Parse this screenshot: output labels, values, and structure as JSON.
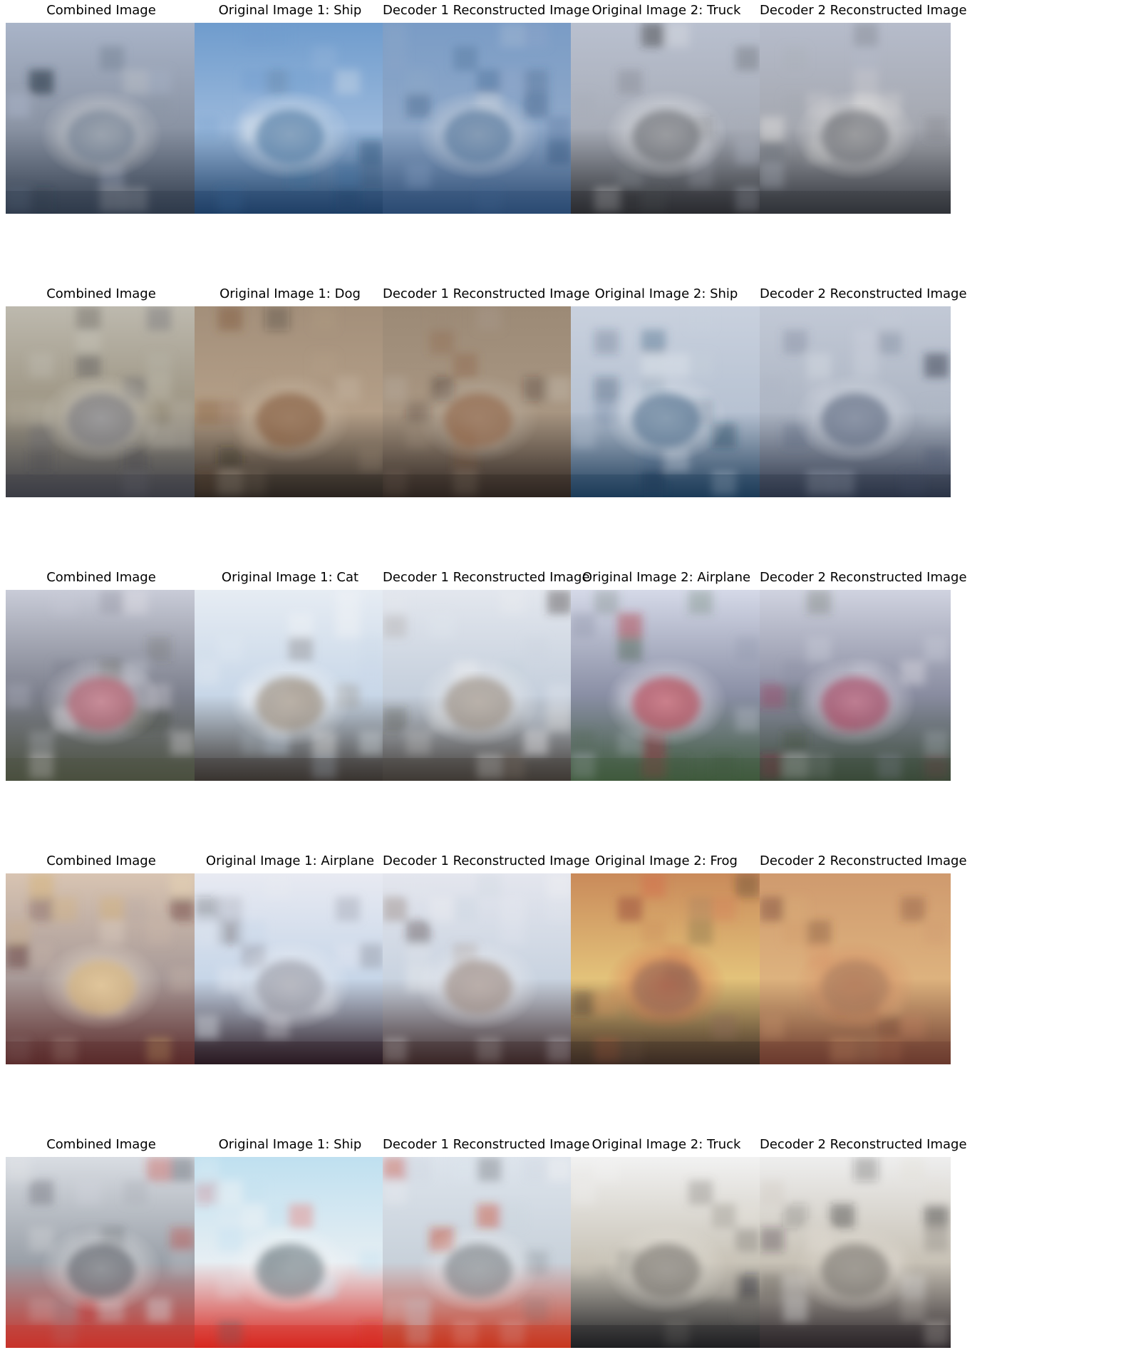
{
  "figure": {
    "rows": [
      {
        "cells": [
          {
            "title": "Combined Image",
            "image": "ship-and-truck-blend",
            "colors": [
              "#a9b4c8",
              "#8a93a3",
              "#e6e4e2",
              "#2f3a4a",
              "#5e6f86"
            ]
          },
          {
            "title": "Original Image 1: Ship",
            "image": "ship-at-sea",
            "colors": [
              "#6f9ccd",
              "#9ab8db",
              "#e9ecf0",
              "#1f4066",
              "#3a6a98"
            ]
          },
          {
            "title": "Decoder 1 Reconstructed Image",
            "image": "blurry-ship-reconstruction",
            "colors": [
              "#7a9cc6",
              "#8fa8c8",
              "#dcdfe4",
              "#2b4a72",
              "#3f6690"
            ]
          },
          {
            "title": "Original Image 2: Truck",
            "image": "white-box-truck",
            "colors": [
              "#b9c0cf",
              "#a8adb8",
              "#f2f2f2",
              "#2a2c30",
              "#55585e"
            ]
          },
          {
            "title": "Decoder 2 Reconstructed Image",
            "image": "blurry-truck-reconstruction",
            "colors": [
              "#b6bccb",
              "#a5a8b0",
              "#ebe9e6",
              "#303339",
              "#5c5f66"
            ]
          }
        ]
      },
      {
        "cells": [
          {
            "title": "Combined Image",
            "image": "dog-and-ship-blend",
            "colors": [
              "#bdb9ae",
              "#9c9482",
              "#d9d7d0",
              "#3b3d45",
              "#6a6a72"
            ]
          },
          {
            "title": "Original Image 1: Dog",
            "image": "dog-lying-on-ground",
            "colors": [
              "#a38f7a",
              "#b49f88",
              "#c9b9a5",
              "#2a2420",
              "#7a4e2d"
            ]
          },
          {
            "title": "Decoder 1 Reconstructed Image",
            "image": "blurry-dog-reconstruction",
            "colors": [
              "#9c8a76",
              "#a89682",
              "#beb3a4",
              "#2d2420",
              "#8a5a3a"
            ]
          },
          {
            "title": "Original Image 2: Ship",
            "image": "ship-in-harbor",
            "colors": [
              "#c9d1de",
              "#b7c2d2",
              "#e7ebf0",
              "#1d3b58",
              "#3d5f80"
            ]
          },
          {
            "title": "Decoder 2 Reconstructed Image",
            "image": "blurry-harbor-ship-reconstruction",
            "colors": [
              "#c2c9d6",
              "#aeb6c4",
              "#dfe3ea",
              "#2a3346",
              "#4a5670"
            ]
          }
        ]
      },
      {
        "cells": [
          {
            "title": "Combined Image",
            "image": "cat-and-airplane-blend",
            "colors": [
              "#c9ccd8",
              "#7c7f8c",
              "#e8e4ea",
              "#4a4f3e",
              "#b04a5a"
            ]
          },
          {
            "title": "Original Image 1: Cat",
            "image": "sitting-cat",
            "colors": [
              "#e6ecf3",
              "#c8d7e8",
              "#f7f7f7",
              "#3a3530",
              "#8a7a68"
            ]
          },
          {
            "title": "Decoder 1 Reconstructed Image",
            "image": "blurry-cat-reconstruction",
            "colors": [
              "#e3e7ee",
              "#c5cfdc",
              "#f2f2f2",
              "#3f3a35",
              "#8c7e70"
            ]
          },
          {
            "title": "Original Image 2: Airplane",
            "image": "small-airplane-on-grass",
            "colors": [
              "#d5d9e8",
              "#8a8fa5",
              "#f1eef3",
              "#3f5a3c",
              "#b02a3a"
            ]
          },
          {
            "title": "Decoder 2 Reconstructed Image",
            "image": "blurry-airplane-reconstruction",
            "colors": [
              "#d0d3e0",
              "#898ca0",
              "#ece8ef",
              "#3a4a38",
              "#9c2c48"
            ]
          }
        ]
      },
      {
        "cells": [
          {
            "title": "Combined Image",
            "image": "airplane-and-frog-blend",
            "colors": [
              "#d8c4b2",
              "#a89a98",
              "#efe3d2",
              "#5a2a2a",
              "#d6b070"
            ]
          },
          {
            "title": "Original Image 1: Airplane",
            "image": "dark-airplane-in-sky",
            "colors": [
              "#e8eaf2",
              "#c7d6e8",
              "#f3f3f6",
              "#2a1a22",
              "#8a8c98"
            ]
          },
          {
            "title": "Decoder 1 Reconstructed Image",
            "image": "blurry-dark-airplane-reconstruction",
            "colors": [
              "#e4e6ee",
              "#c9d3e0",
              "#f0f0f2",
              "#3a2626",
              "#8f7a70"
            ]
          },
          {
            "title": "Original Image 2: Frog",
            "image": "frog-on-colorful-ground",
            "colors": [
              "#c98a5a",
              "#e3c27a",
              "#d46a4a",
              "#3a2a22",
              "#8a6a5a"
            ]
          },
          {
            "title": "Decoder 2 Reconstructed Image",
            "image": "blurry-frog-reconstruction",
            "colors": [
              "#cf9a6e",
              "#ddb27e",
              "#d58a62",
              "#6a3a2e",
              "#a07a5e"
            ]
          }
        ]
      },
      {
        "cells": [
          {
            "title": "Combined Image",
            "image": "ship-and-truck-blend",
            "colors": [
              "#d9dde3",
              "#9aa0a8",
              "#f1f1f1",
              "#c8332a",
              "#4a4e56"
            ]
          },
          {
            "title": "Original Image 1: Ship",
            "image": "red-sailing-ship",
            "colors": [
              "#bfe0f0",
              "#e6eef3",
              "#f6f6f6",
              "#d8271f",
              "#5a6a72"
            ]
          },
          {
            "title": "Decoder 1 Reconstructed Image",
            "image": "blurry-red-ship-reconstruction",
            "colors": [
              "#dde4ec",
              "#c8d1da",
              "#f1f2f4",
              "#c8361f",
              "#6a6f74"
            ]
          },
          {
            "title": "Original Image 2: Truck",
            "image": "tow-truck",
            "colors": [
              "#f2f2f2",
              "#c9c4b8",
              "#e6e2da",
              "#1f1f22",
              "#6a6660"
            ]
          },
          {
            "title": "Decoder 2 Reconstructed Image",
            "image": "blurry-tow-truck-reconstruction",
            "colors": [
              "#eeeeee",
              "#c8c2b6",
              "#e2ddd4",
              "#2a2428",
              "#6c6862"
            ]
          }
        ]
      }
    ]
  }
}
